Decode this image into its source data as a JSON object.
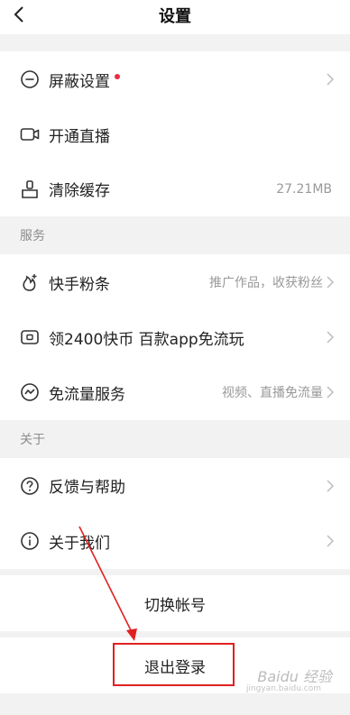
{
  "header": {
    "title": "设置",
    "back_icon": "chevron-left-icon"
  },
  "group1": [
    {
      "label": "屏蔽设置",
      "icon": "minus-circle-icon",
      "has_dot": true,
      "dot_color": "#ee2d45"
    },
    {
      "label": "开通直播",
      "icon": "video-camera-icon"
    },
    {
      "label": "清除缓存",
      "icon": "broom-icon",
      "value": "27.21MB"
    }
  ],
  "section_services": "服务",
  "group2": [
    {
      "label": "快手粉条",
      "icon": "flame-plus-icon",
      "sub": "推广作品，收获粉丝"
    },
    {
      "label": "领2400快币 百款app免流玩",
      "icon": "card-icon"
    },
    {
      "label": "免流量服务",
      "icon": "wave-circle-icon",
      "sub": "视频、直播免流量"
    }
  ],
  "section_about": "关于",
  "group3": [
    {
      "label": "反馈与帮助",
      "icon": "question-circle-icon"
    },
    {
      "label": "关于我们",
      "icon": "info-circle-icon"
    }
  ],
  "actions": {
    "switch_account": "切换帐号",
    "logout": "退出登录"
  },
  "annotation": {
    "highlight_color": "#e02020"
  }
}
